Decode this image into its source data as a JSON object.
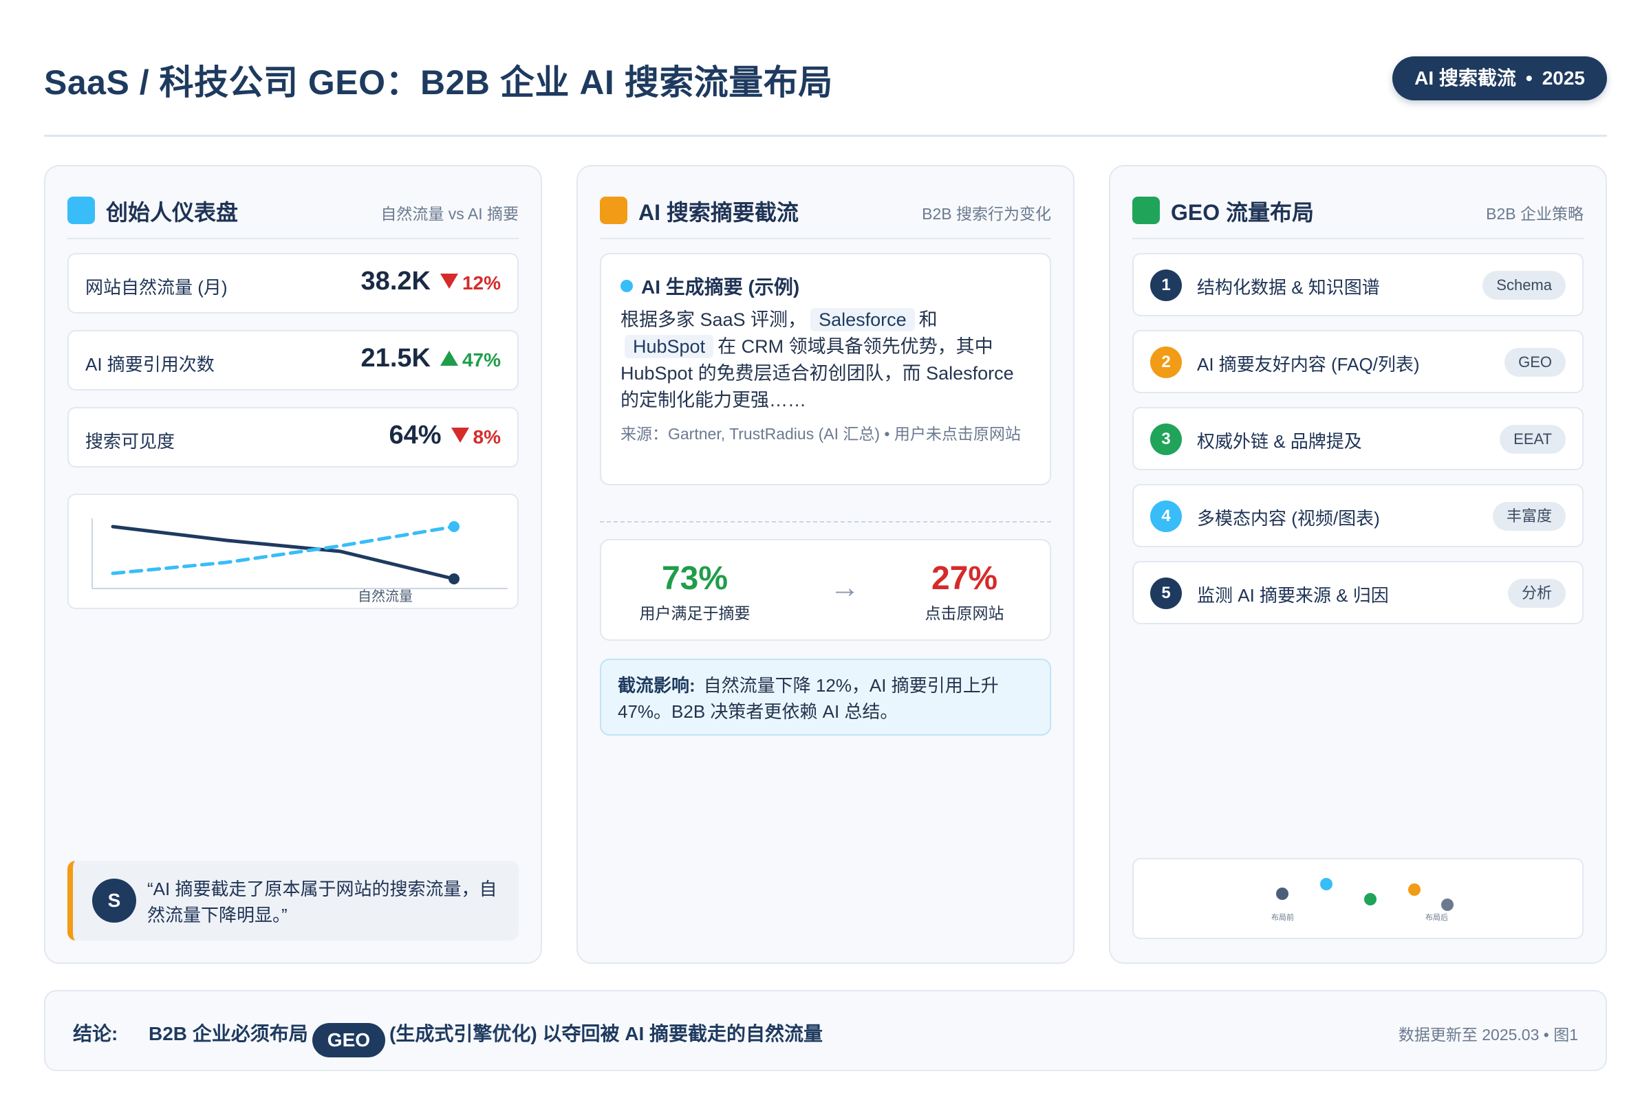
{
  "header": {
    "title": "SaaS / 科技公司 GEO：B2B 企业 AI 搜索流量布局",
    "tag": "AI 搜索截流",
    "tag_sep": "•",
    "tag_year": "2025"
  },
  "colors": {
    "navy": "#1e3a5f",
    "sky": "#38bdf8",
    "orange": "#f29b16",
    "green": "#1fa45a",
    "red": "#d52b2b"
  },
  "dashboard": {
    "title": "创始人仪表盘",
    "subtitle": "自然流量 vs AI 摘要",
    "metrics": [
      {
        "label": "网站自然流量 (月)",
        "value": "38.2K",
        "delta": "12%",
        "direction": "down"
      },
      {
        "label": "AI 摘要引用次数",
        "value": "21.5K",
        "delta": "47%",
        "direction": "up"
      },
      {
        "label": "搜索可见度",
        "value": "64%",
        "delta": "8%",
        "direction": "down"
      }
    ],
    "chart_label": "自然流量",
    "quote_avatar": "S",
    "quote": "“AI 摘要截走了原本属于网站的搜索流量，自然流量下降明显。”"
  },
  "chart_data": {
    "type": "line",
    "title": "",
    "x": [
      0,
      1,
      2,
      3
    ],
    "series": [
      {
        "name": "自然流量",
        "values": [
          1.0,
          0.75,
          0.55,
          0.05
        ],
        "color": "#1e3a5f",
        "style": "solid"
      },
      {
        "name": "",
        "values": [
          0.15,
          0.35,
          0.65,
          1.0
        ],
        "color": "#38bdf8",
        "style": "dashed"
      }
    ],
    "xlabel": "",
    "ylabel": "",
    "grid": false
  },
  "interception": {
    "title": "AI 搜索摘要截流",
    "subtitle": "B2B 搜索行为变化",
    "summary_title": "AI 生成摘要 (示例)",
    "summary_pre": "根据多家 SaaS 评测，",
    "brand1": "Salesforce",
    "summary_and": "和",
    "brand2": "HubSpot",
    "summary_post": "在 CRM 领域具备领先优势，其中 HubSpot 的免费层适合初创团队，而 Salesforce 的定制化能力更强……",
    "source": "来源：Gartner, TrustRadius (AI 汇总) • 用户未点击原网站",
    "stat_left_value": "73%",
    "stat_left_label": "用户满足于摘要",
    "arrow": "→",
    "stat_right_value": "27%",
    "stat_right_label": "点击原网站",
    "impact_label": "截流影响:",
    "impact_text": "自然流量下降 12%，AI 摘要引用上升 47%。B2B 决策者更依赖 AI 总结。"
  },
  "geo": {
    "title": "GEO 流量布局",
    "subtitle": "B2B 企业策略",
    "steps": [
      {
        "num": "1",
        "label": "结构化数据 & 知识图谱",
        "badge": "Schema",
        "color": "#1e3a5f"
      },
      {
        "num": "2",
        "label": "AI 摘要友好内容 (FAQ/列表)",
        "badge": "GEO",
        "color": "#f29b16"
      },
      {
        "num": "3",
        "label": "权威外链 & 品牌提及",
        "badge": "EEAT",
        "color": "#1fa45a"
      },
      {
        "num": "4",
        "label": "多模态内容 (视频/图表)",
        "badge": "丰富度",
        "color": "#38bdf8"
      },
      {
        "num": "5",
        "label": "监测 AI 摘要来源 & 归因",
        "badge": "分析",
        "color": "#1e3a5f"
      }
    ],
    "mini_before": "布局前",
    "mini_after": "布局后"
  },
  "footer": {
    "lead": "结论:",
    "text_pre": "B2B 企业必须布局",
    "pill": "GEO",
    "text_post": "(生成式引擎优化) 以夺回被 AI 摘要截走的自然流量",
    "meta": "数据更新至 2025.03 • 图1"
  }
}
